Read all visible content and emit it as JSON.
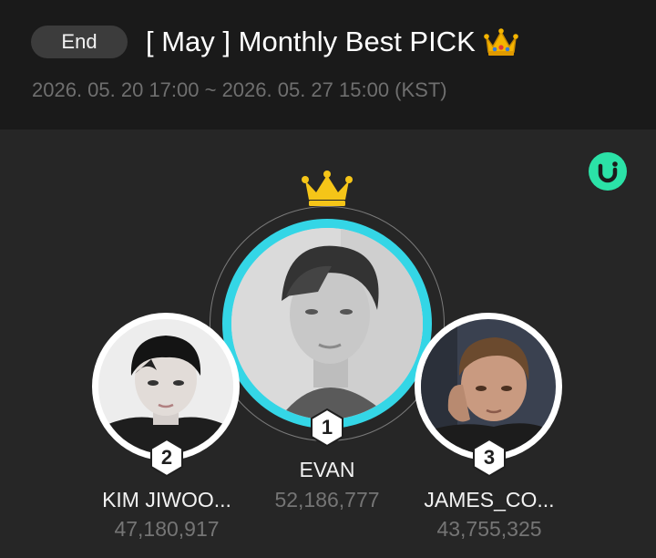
{
  "header": {
    "status": "End",
    "title": "[ May ] Monthly Best PICK",
    "title_icon": "crown-emoji-icon",
    "period": "2026. 05. 20 17:00 ~ 2026. 05. 27 15:00 (KST)"
  },
  "brand_icon": "u-logo-icon",
  "colors": {
    "background": "#1a1a1a",
    "panel": "#262626",
    "first_ring": "#34d6e6",
    "brand_badge": "#2be2a7",
    "gold": "#f5c518",
    "pill": "#3c3c3c"
  },
  "ranking": [
    {
      "rank": "1",
      "name": "EVAN",
      "votes": "52,186,777",
      "crown_icon": "gold-crown-icon"
    },
    {
      "rank": "2",
      "name": "KIM JIWOO...",
      "votes": "47,180,917"
    },
    {
      "rank": "3",
      "name": "JAMES_CO...",
      "votes": "43,755,325"
    }
  ]
}
